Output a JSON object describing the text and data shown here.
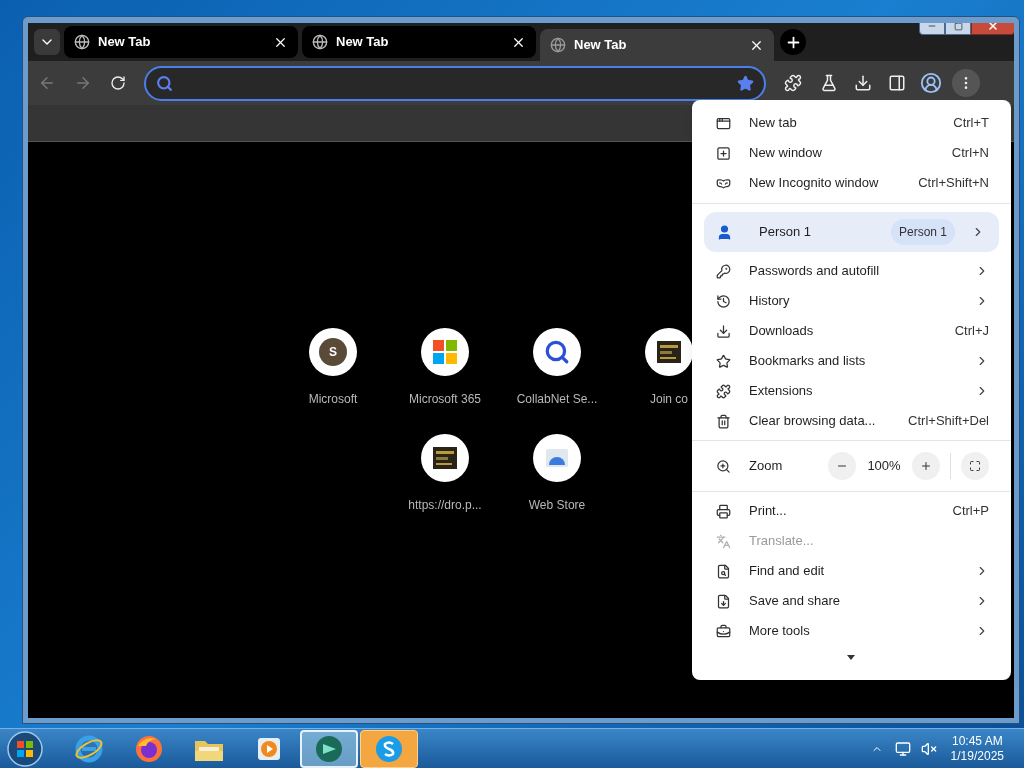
{
  "browser": {
    "tabs": [
      {
        "title": "New Tab",
        "selected": false
      },
      {
        "title": "New Tab",
        "selected": false
      },
      {
        "title": "New Tab",
        "selected": true
      }
    ],
    "omnibox": {
      "focused": true,
      "bookmarked": true
    },
    "shortcuts": [
      {
        "title": "Microsoft",
        "kind": "letter",
        "letter": "S"
      },
      {
        "title": "Microsoft 365",
        "kind": "windows-logo"
      },
      {
        "title": "CollabNet Se...",
        "kind": "search"
      },
      {
        "title": "Join co",
        "kind": "thumbnail"
      },
      {
        "title": "https://dro.p...",
        "kind": "thumbnail"
      },
      {
        "title": "Web Store",
        "kind": "webstore"
      }
    ]
  },
  "menu": {
    "sections": [
      [
        {
          "kind": "item",
          "label": "New tab",
          "shortcut": "Ctrl+T",
          "disabled": false
        },
        {
          "kind": "item",
          "label": "New window",
          "shortcut": "Ctrl+N",
          "disabled": false
        },
        {
          "kind": "item",
          "label": "New Incognito window",
          "shortcut": "Ctrl+Shift+N",
          "disabled": false
        }
      ],
      [
        {
          "kind": "profile",
          "label": "Person 1",
          "badge": "Person 1",
          "submenu": true,
          "highlighted": true
        },
        {
          "kind": "item",
          "label": "Passwords and autofill",
          "submenu": true,
          "disabled": false
        },
        {
          "kind": "item",
          "label": "History",
          "submenu": true,
          "disabled": false
        },
        {
          "kind": "item",
          "label": "Downloads",
          "shortcut": "Ctrl+J",
          "disabled": false
        },
        {
          "kind": "item",
          "label": "Bookmarks and lists",
          "submenu": true,
          "disabled": false
        },
        {
          "kind": "item",
          "label": "Extensions",
          "submenu": true,
          "disabled": false
        },
        {
          "kind": "item",
          "label": "Clear browsing data...",
          "shortcut": "Ctrl+Shift+Del",
          "disabled": false
        }
      ],
      [
        {
          "kind": "zoom",
          "label": "Zoom",
          "value": "100%"
        }
      ],
      [
        {
          "kind": "item",
          "label": "Print...",
          "shortcut": "Ctrl+P",
          "disabled": false
        },
        {
          "kind": "item",
          "label": "Translate...",
          "disabled": true
        },
        {
          "kind": "item",
          "label": "Find and edit",
          "submenu": true,
          "disabled": false
        },
        {
          "kind": "item",
          "label": "Save and share",
          "submenu": true,
          "disabled": false
        },
        {
          "kind": "item",
          "label": "More tools",
          "submenu": true,
          "disabled": false
        }
      ]
    ]
  },
  "taskbar": {
    "apps": [
      {
        "kind": "ie",
        "selected": false,
        "attention": false
      },
      {
        "kind": "firefox",
        "selected": false,
        "attention": false
      },
      {
        "kind": "folder",
        "selected": false,
        "attention": false
      },
      {
        "kind": "media",
        "selected": false,
        "attention": false
      },
      {
        "kind": "teal",
        "selected": true,
        "attention": false
      },
      {
        "kind": "skype",
        "selected": false,
        "attention": true
      }
    ],
    "clock": {
      "time": "10:45 AM",
      "date": "1/19/2025"
    }
  }
}
